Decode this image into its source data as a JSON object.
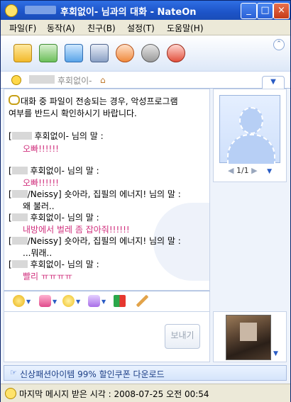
{
  "window": {
    "title": "후회없이- 님과의 대화  - NateOn",
    "minimize_glyph": "_",
    "maximize_glyph": "□",
    "close_glyph": "×"
  },
  "menu": [
    "파일(F)",
    "동작(A)",
    "친구(B)",
    "설정(T)",
    "도움말(H)"
  ],
  "toolbar": {
    "tools": [
      "memo-icon",
      "file-send-icon",
      "photo-album-icon",
      "multi-chat-icon",
      "alarm-icon",
      "remote-control-icon",
      "voice-chat-icon"
    ],
    "expand_glyph": "⌃"
  },
  "tab": {
    "label": "후회없이-",
    "arrow_glyph": "▼"
  },
  "chat": {
    "warning": "대화 중 파일이 전송되는 경우, 악성프로그램 여부를 반드시 확인하시기 바랍니다.",
    "warning_line1": "대화 중 파일이 전송되는 경우, 악성프로그램",
    "warning_line2": "여부를 반드시 확인하시기 바랍니다.",
    "messages": [
      {
        "open": "[",
        "sender": "후회없이-",
        "suffix": " 님의 말 :",
        "body": "오빠!!!!!!",
        "color": "#d0307d"
      },
      {
        "open": "[",
        "sender": "후회없이-",
        "suffix": " 님의 말 :",
        "body": "오빠!!!!!!",
        "color": "#d0307d"
      },
      {
        "open": "[",
        "sender": "/Neissy] 숏아라, 집필의 에너지! 님의 말 :",
        "suffix": "",
        "body": "왜 불러..",
        "color": "#000000"
      },
      {
        "open": "[",
        "sender": "후회없이-",
        "suffix": " 님의 말 :",
        "body": "내방에서 벌레 좀 잡아줘!!!!!!",
        "color": "#d0307d"
      },
      {
        "open": "[",
        "sender": "/Neissy] 숏아라, 집필의 에너지! 님의 말 :",
        "suffix": "",
        "body": "...뭐래..",
        "color": "#000000"
      },
      {
        "open": "[",
        "sender": "후회없이-",
        "suffix": " 님의 말 :",
        "body": "빨리 ㅠㅠㅠㅠ",
        "color": "#d0307d"
      }
    ]
  },
  "profile": {
    "page": "1/1",
    "prev_glyph": "◀",
    "next_glyph": "▶",
    "dropdown_glyph": "▼"
  },
  "input": {
    "send_label": "보내기",
    "emoticons": [
      "smiley-icon",
      "gift-icon",
      "emotion-icon",
      "flashcon-icon",
      "font-icon",
      "brush-icon"
    ]
  },
  "ad": {
    "text": "신상패션아이템 99% 할인쿠폰 다운로드",
    "icon_glyph": "☞"
  },
  "status": {
    "text": "마지막 메시지 받은 시각 : 2008-07-25 오전 00:54"
  }
}
